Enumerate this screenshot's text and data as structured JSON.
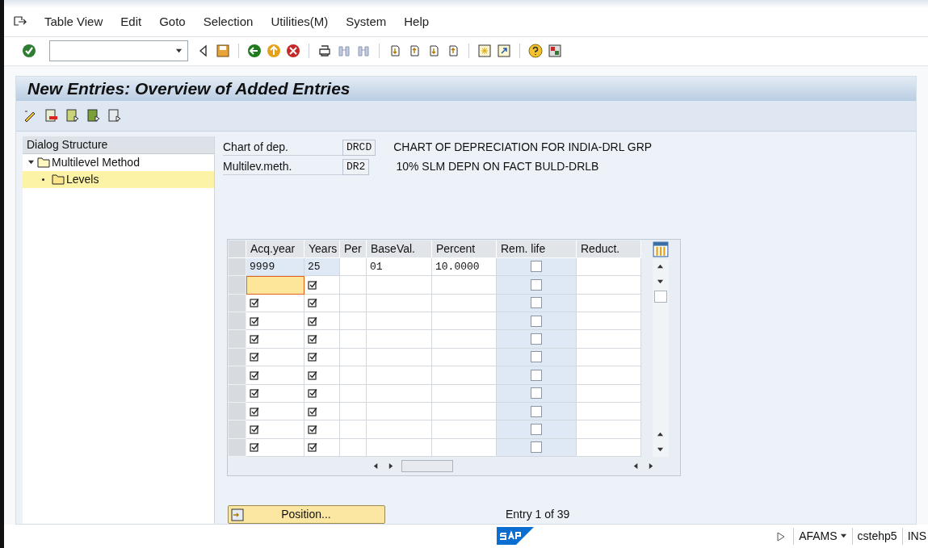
{
  "menu": [
    "Table View",
    "Edit",
    "Goto",
    "Selection",
    "Utilities(M)",
    "System",
    "Help"
  ],
  "title": "New Entries: Overview of Added Entries",
  "dialog_structure": {
    "header": "Dialog Structure",
    "tree": [
      {
        "label": "Multilevel Method",
        "expanded": true,
        "selected": false,
        "children": [
          {
            "label": "Levels",
            "selected": true
          }
        ]
      }
    ]
  },
  "fields": [
    {
      "label": "Chart of dep.",
      "value": "DRCD",
      "description": "CHART OF DEPRECIATION FOR INDIA-DRL GRP"
    },
    {
      "label": "Multilev.meth.",
      "value": "DR2",
      "description": "10% SLM DEPN ON FACT BULD-DRLB"
    }
  ],
  "table": {
    "columns": [
      "Acq.year",
      "Years",
      "Per",
      "BaseVal.",
      "Percent",
      "Rem. life",
      "Reduct."
    ],
    "rows": [
      {
        "kind": "entry",
        "acq_year": "9999",
        "years": "25",
        "base_val": "01",
        "percent": "10.0000",
        "rem_life": false,
        "focused": false
      },
      {
        "kind": "blank",
        "rem_life": false,
        "focused": true
      },
      {
        "kind": "blank",
        "rem_life": false,
        "focused": false
      },
      {
        "kind": "blank",
        "rem_life": false,
        "focused": false
      },
      {
        "kind": "blank",
        "rem_life": false,
        "focused": false
      },
      {
        "kind": "blank",
        "rem_life": false,
        "focused": false
      },
      {
        "kind": "blank",
        "rem_life": false,
        "focused": false
      },
      {
        "kind": "blank",
        "rem_life": false,
        "focused": false
      },
      {
        "kind": "blank",
        "rem_life": false,
        "focused": false
      },
      {
        "kind": "blank",
        "rem_life": false,
        "focused": false
      },
      {
        "kind": "blank",
        "rem_life": false,
        "focused": false
      }
    ]
  },
  "position_button": "Position...",
  "entry_count": "Entry 1 of 39",
  "status_bar": {
    "transaction": "AFAMS",
    "server": "cstehp5",
    "mode": "INS"
  }
}
